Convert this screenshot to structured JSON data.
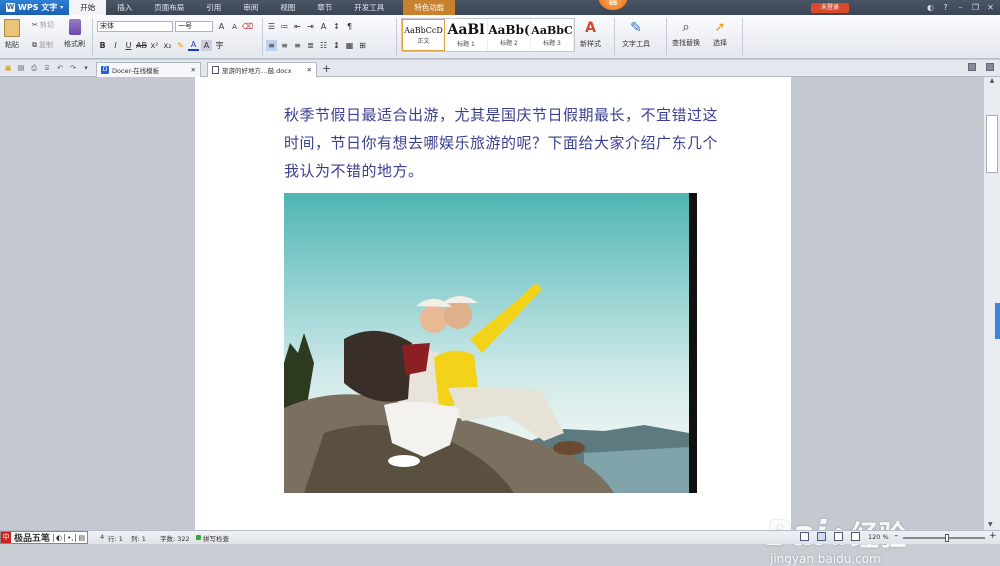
{
  "app": {
    "name": "WPS 文字",
    "badge": "68",
    "login": "未登录"
  },
  "menu": [
    "开始",
    "插入",
    "页面布局",
    "引用",
    "审阅",
    "视图",
    "章节",
    "开发工具",
    "特色功能"
  ],
  "toolbar": {
    "paste": "粘贴",
    "cut": "剪切",
    "copy": "复制",
    "format_painter": "格式刷",
    "font": "宋体",
    "font_size": "一号",
    "styles": [
      {
        "sample": "AaBbCcD",
        "name": "正文"
      },
      {
        "sample": "AaBl",
        "name": "标题 1"
      },
      {
        "sample": "AaBb(",
        "name": "标题 2"
      },
      {
        "sample": "AaBbC",
        "name": "标题 3"
      }
    ],
    "new_style": "新样式",
    "text_tools": "文字工具",
    "find_replace": "查找替换",
    "select": "选择"
  },
  "tabs": [
    {
      "label": "Docer-在线模板"
    },
    {
      "label": "旅游的好地方…鼓.docx"
    }
  ],
  "document": {
    "paragraph": "秋季节假日最适合出游，尤其是国庆节日假期最长，不宜错过这时间，节日你有想去哪娱乐旅游的呢？下面给大家介绍广东几个我认为不错的地方。"
  },
  "status": {
    "ime": "极品五笔",
    "page": "4",
    "row": "行: 1",
    "col": "列: 1",
    "words": "字数: 322",
    "spell": "拼写检查",
    "zoom": "120 %"
  },
  "watermark": {
    "brand": "Bai",
    "cn": "经验",
    "url": "jingyan.baidu.com"
  }
}
